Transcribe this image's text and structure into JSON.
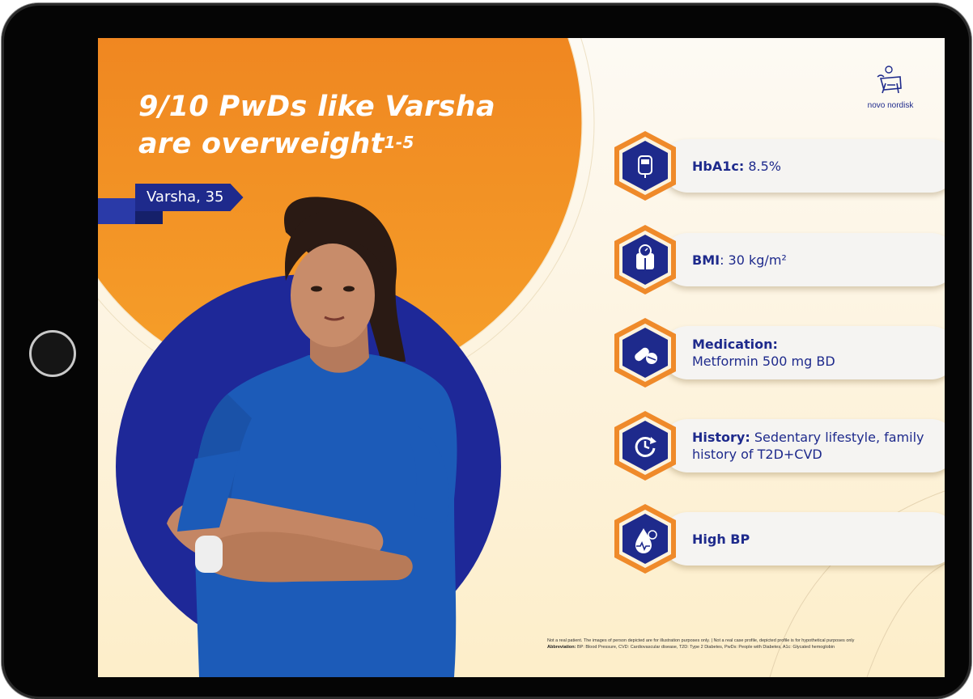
{
  "headline": {
    "line1": "9/10 PwDs like Varsha",
    "line2": "are overweight",
    "superscript": "1-5"
  },
  "name_tag": "Varsha, 35",
  "brand": {
    "name": "novo nordisk"
  },
  "cards": [
    {
      "label": "HbA1c:",
      "value": " 8.5%",
      "icon": "glucometer-icon"
    },
    {
      "label": "BMI",
      "value": ": 30 kg/m²",
      "icon": "weighing-scale-icon"
    },
    {
      "label": "Medication:",
      "value": "Metformin 500 mg BD",
      "icon": "pills-icon"
    },
    {
      "label": "History:",
      "value": " Sedentary lifestyle, family history of T2D+CVD",
      "icon": "history-icon"
    },
    {
      "label": "High BP",
      "value": "",
      "icon": "blood-pressure-icon"
    }
  ],
  "footnote": {
    "disclaimer": "Not a real patient. The images of person depicted are for illustration purposes only.   |   Not a real case profile, depicted profile is for hypothetical purposes only",
    "abbrev_label": "Abbreviation:",
    "abbrev_text": " BP: Blood Pressure, CVD: Cardiovascular disease, T2D: Type 2 Diabetes, PwDs: People with Diabetes, A1c: Glycated hemoglobin"
  },
  "colors": {
    "orange": "#f07f1a",
    "navy": "#1e2a8c",
    "hex_orange": "#ef8a2a",
    "cream": "#fdf3dd"
  }
}
